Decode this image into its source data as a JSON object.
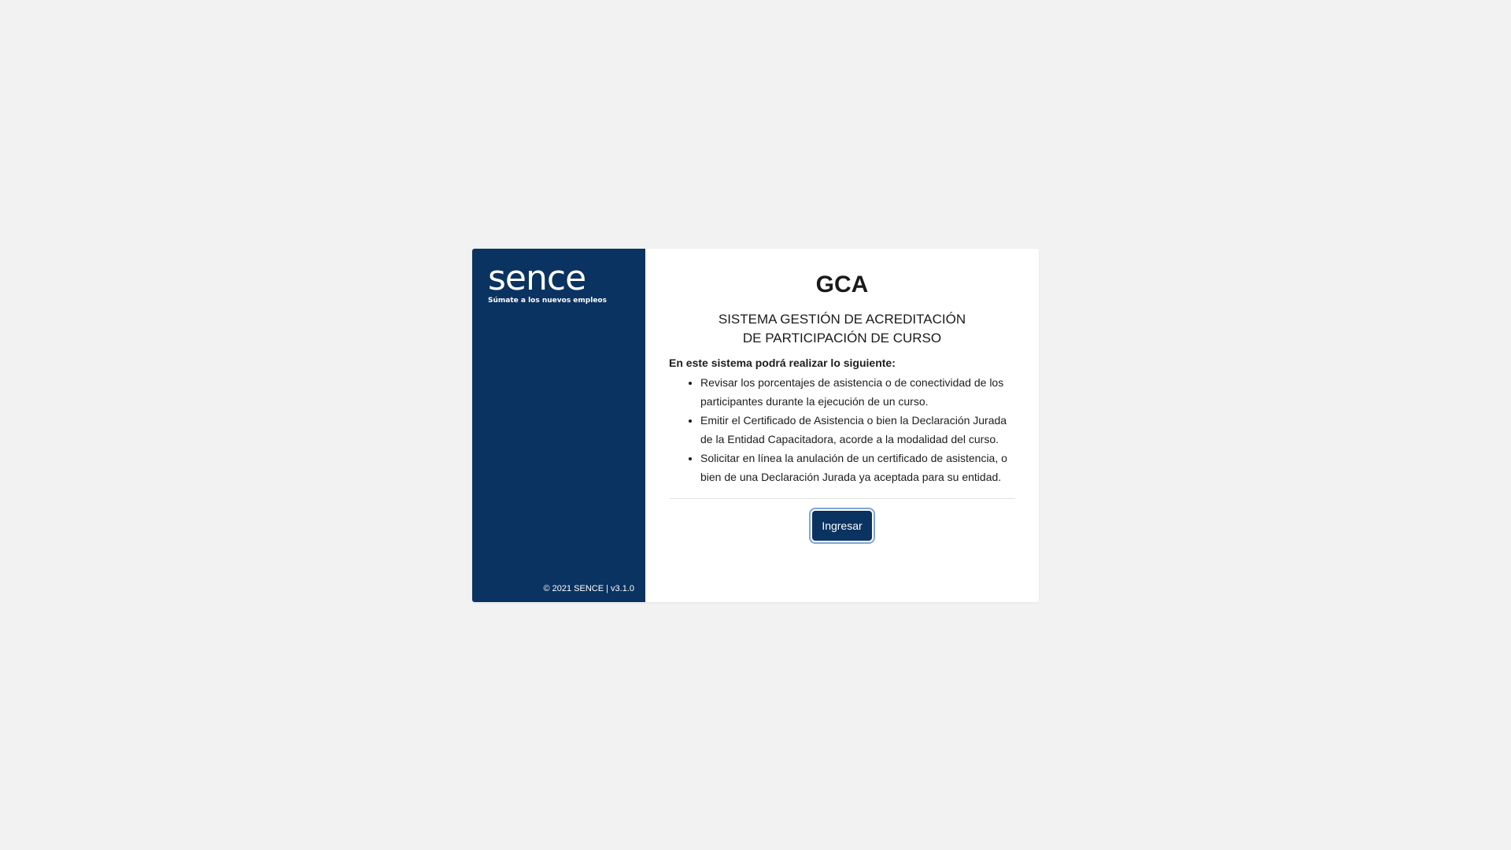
{
  "brand": {
    "logo_word": "sence",
    "logo_tagline": "Súmate a los nuevos empleos",
    "footer": "© 2021 SENCE | v3.1.0",
    "colors": {
      "sidebar": "#0b3361",
      "background": "#f2f2f2",
      "button": "#0b3361"
    }
  },
  "main": {
    "title": "GCA",
    "subtitle": "SISTEMA GESTIÓN DE ACREDITACIÓN DE PARTICIPACIÓN DE CURSO",
    "intro": "En este sistema podrá realizar lo siguiente:",
    "features": [
      "Revisar los porcentajes de asistencia o de conectividad de los participantes durante la ejecución de un curso.",
      "Emitir el Certificado de Asistencia o bien la Declaración Jurada de la Entidad Capacitadora, acorde a la modalidad del curso.",
      "Solicitar en línea la anulación de un certificado de asistencia, o bien de una Declaración Jurada ya aceptada para su entidad."
    ],
    "login_label": "Ingresar"
  }
}
